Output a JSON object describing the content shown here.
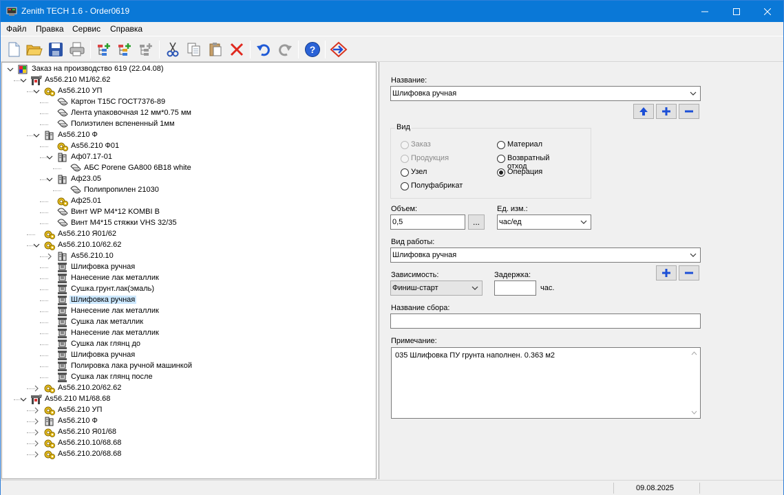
{
  "window": {
    "title": "Zenith TECH 1.6 - Order0619"
  },
  "menu": [
    {
      "label": "Файл"
    },
    {
      "label": "Правка"
    },
    {
      "label": "Сервис"
    },
    {
      "label": "Справка"
    }
  ],
  "tree": {
    "root": "Заказ на производство 619 (22.04.08)",
    "rows": [
      {
        "label": "As56.210 M1/62.62"
      },
      {
        "label": "As56.210 УП"
      },
      {
        "label": "Картон Т15С ГОСТ7376-89"
      },
      {
        "label": "Лента упаковочная 12 мм*0.75 мм"
      },
      {
        "label": "Полиэтилен вспененный 1мм"
      },
      {
        "label": "As56.210 Ф"
      },
      {
        "label": "As56.210 Ф01"
      },
      {
        "label": "Аф07.17-01"
      },
      {
        "label": "АБС Porene GA800 6B18 white"
      },
      {
        "label": "Аф23.05"
      },
      {
        "label": "Полипропилен 21030"
      },
      {
        "label": "Аф25.01"
      },
      {
        "label": "Винт WP M4*12 KOMBI B"
      },
      {
        "label": "Винт M4*15 стяжки VHS 32/35"
      },
      {
        "label": "As56.210 Я01/62"
      },
      {
        "label": "As56.210.10/62.62"
      },
      {
        "label": "As56.210.10"
      },
      {
        "label": "Шлифовка ручная"
      },
      {
        "label": "Нанесение лак металлик"
      },
      {
        "label": "Сушка.грунт.лак(эмаль)"
      },
      {
        "label": "Шлифовка ручная"
      },
      {
        "label": "Нанесение лак металлик"
      },
      {
        "label": "Сушка лак металлик"
      },
      {
        "label": "Нанесение лак металлик"
      },
      {
        "label": "Сушка лак глянц до"
      },
      {
        "label": "Шлифовка ручная"
      },
      {
        "label": "Полировка лака ручной машинкой"
      },
      {
        "label": "Сушка лак глянц после"
      },
      {
        "label": "As56.210.20/62.62"
      },
      {
        "label": "As56.210 M1/68.68"
      },
      {
        "label": "As56.210 УП"
      },
      {
        "label": "As56.210 Ф"
      },
      {
        "label": "As56.210 Я01/68"
      },
      {
        "label": "As56.210.10/68.68"
      },
      {
        "label": "As56.210.20/68.68"
      }
    ]
  },
  "form": {
    "name_label": "Название:",
    "name_value": "Шлифовка ручная",
    "kind_label": "Вид",
    "kind_options": [
      {
        "label": "Заказ"
      },
      {
        "label": "Продукция"
      },
      {
        "label": "Узел"
      },
      {
        "label": "Полуфабрикат"
      },
      {
        "label": "Материал"
      },
      {
        "label": "Возвратный отход"
      },
      {
        "label": "Операция"
      }
    ],
    "kind_selected": "Операция",
    "volume_label": "Объем:",
    "volume_value": "0,5",
    "browse_label": "...",
    "unit_label": "Ед. изм.:",
    "unit_value": "час/ед",
    "worktype_label": "Вид работы:",
    "worktype_value": "Шлифовка ручная",
    "dependency_label": "Зависимость:",
    "dependency_value": "Финиш-старт",
    "delay_label": "Задержка:",
    "delay_value": "",
    "delay_unit": "час.",
    "assembly_label": "Название сбора:",
    "assembly_value": "",
    "note_label": "Примечание:",
    "note_value": "035 Шлифовка ПУ грунта наполнен. 0.363 м2"
  },
  "status": {
    "date": "09.08.2025"
  },
  "colors": {
    "titlebar": "#0a78d7",
    "selection": "#cce8ff",
    "accent_blue": "#1c4fd6"
  }
}
